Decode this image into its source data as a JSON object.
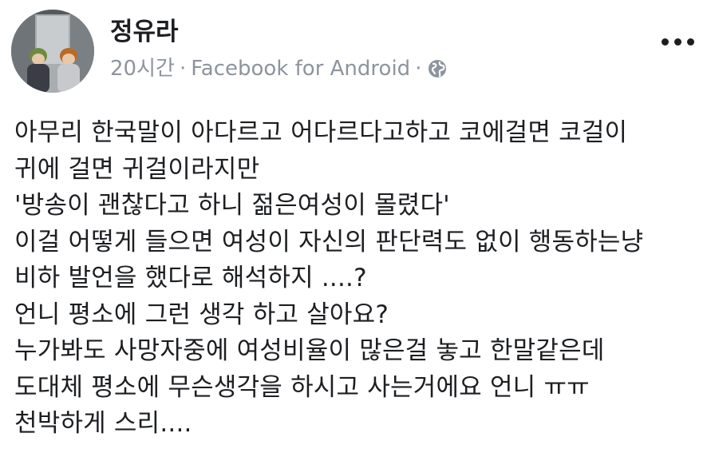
{
  "post": {
    "author": "정유라",
    "time": "20시간",
    "separator": "·",
    "source": "Facebook for Android",
    "privacy_icon": "globe-icon",
    "menu_icon": "more-options-icon",
    "lines": [
      "아무리 한국말이 아다르고 어다르다고하고 코에걸면 코걸이",
      "귀에 걸면 귀걸이라지만",
      "'방송이 괜찮다고 하니 젊은여성이 몰렸다'",
      "이걸 어떻게 들으면 여성이 자신의 판단력도 없이 행동하는냥",
      "비하 발언을 했다로 해석하지 ....?",
      "언니 평소에 그런 생각 하고 살아요?",
      "누가봐도 사망자중에 여성비율이 많은걸 놓고 한말같은데",
      "도대체 평소에 무슨생각을 하시고 사는거에요 언니 ㅠㅠ",
      "천박하게 스리...."
    ]
  },
  "colors": {
    "text": "#1c1e21",
    "meta": "#8d949e",
    "background": "#ffffff"
  }
}
